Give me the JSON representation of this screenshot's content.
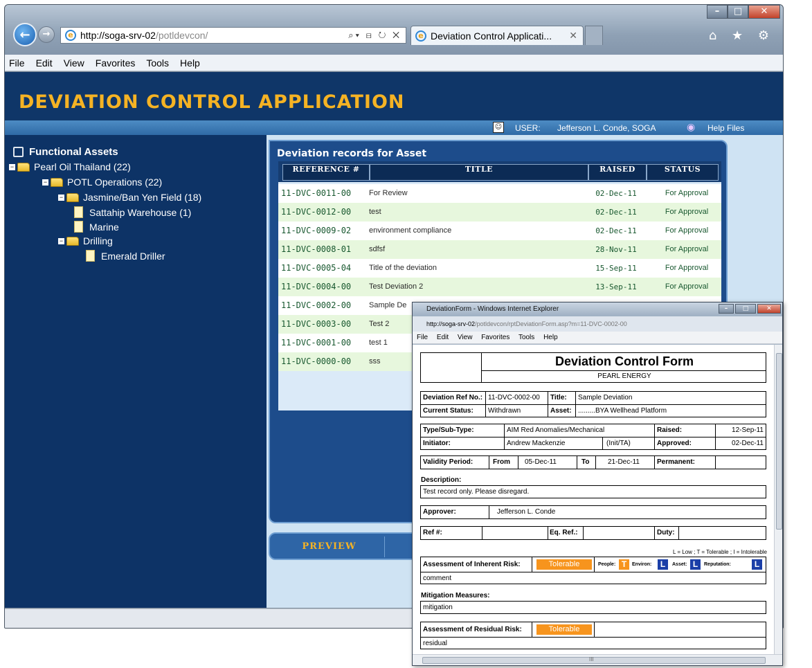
{
  "browser": {
    "url_host": "http://soga-srv-02",
    "url_path": "/potldevcon/",
    "address_tools": "⌕▾ ⊟ ↻ ✕",
    "tab_title": "Deviation Control Applicati...",
    "tab_close": "✕",
    "caption": {
      "minimize": "–",
      "maximize": "□",
      "close": "✕"
    },
    "right_icons": "⌂ ★ ⚙",
    "menu": [
      "File",
      "Edit",
      "View",
      "Favorites",
      "Tools",
      "Help"
    ]
  },
  "app": {
    "title": "DEVIATION CONTROL APPLICATION",
    "user_label": "USER:",
    "user_name": "Jefferson L. Conde, SOGA",
    "help_label": "Help Files"
  },
  "tree": {
    "root": "Functional Assets",
    "nodes": [
      "Pearl Oil Thailand (22)",
      "POTL Operations (22)",
      "Jasmine/Ban Yen Field (18)",
      "Sattahip Warehouse (1)",
      "Marine",
      "Drilling",
      "Emerald Driller"
    ]
  },
  "records": {
    "title": "Deviation records for Asset",
    "columns": [
      "REFERENCE #",
      "TITLE",
      "RAISED",
      "STATUS"
    ],
    "rows": [
      {
        "ref": "11-DVC-0011-00",
        "title": "For Review",
        "raised": "02-Dec-11",
        "status": "For Approval"
      },
      {
        "ref": "11-DVC-0012-00",
        "title": "test",
        "raised": "02-Dec-11",
        "status": "For Approval"
      },
      {
        "ref": "11-DVC-0009-02",
        "title": "environment compliance",
        "raised": "02-Dec-11",
        "status": "For Approval"
      },
      {
        "ref": "11-DVC-0008-01",
        "title": "sdfsf",
        "raised": "28-Nov-11",
        "status": "For Approval"
      },
      {
        "ref": "11-DVC-0005-04",
        "title": "Title of the deviation",
        "raised": "15-Sep-11",
        "status": "For Approval"
      },
      {
        "ref": "11-DVC-0004-00",
        "title": "Test Deviation 2",
        "raised": "13-Sep-11",
        "status": "For Approval"
      },
      {
        "ref": "11-DVC-0002-00",
        "title": "Sample De",
        "raised": "",
        "status": ""
      },
      {
        "ref": "11-DVC-0003-00",
        "title": "Test 2",
        "raised": "",
        "status": ""
      },
      {
        "ref": "11-DVC-0001-00",
        "title": "test 1",
        "raised": "",
        "status": ""
      },
      {
        "ref": "11-DVC-0000-00",
        "title": "sss",
        "raised": "",
        "status": ""
      }
    ],
    "preview_button": "PREVIEW"
  },
  "popup": {
    "window_title": "DeviationForm - Windows Internet Explorer",
    "url_host": "http://soga-srv-02",
    "url_path": "/potldevcon/rptDeviationForm.asp?m=11-DVC-0002-00",
    "menu": [
      "File",
      "Edit",
      "View",
      "Favorites",
      "Tools",
      "Help"
    ],
    "caption": {
      "minimize": "–",
      "maximize": "□",
      "close": "✕"
    },
    "form": {
      "heading": "Deviation Control Form",
      "company": "PEARL ENERGY",
      "ref_label": "Deviation Ref No.:",
      "ref_value": "11-DVC-0002-00",
      "title_label": "Title:",
      "title_value": "Sample Deviation",
      "status_label": "Current Status:",
      "status_value": "Withdrawn",
      "asset_label": "Asset:",
      "asset_value": ".........BYA Wellhead Platform",
      "type_label": "Type/Sub-Type:",
      "type_value": "AIM Red Anomalies/Mechanical",
      "raised_label": "Raised:",
      "raised_value": "12-Sep-11",
      "initiator_label": "Initiator:",
      "initiator_value": "Andrew Mackenzie",
      "init_ta": "(Init/TA)",
      "approved_label": "Approved:",
      "approved_value": "02-Dec-11",
      "validity_label": "Validity Period:",
      "from_label": "From",
      "from_value": "05-Dec-11",
      "to_label": "To",
      "to_value": "21-Dec-11",
      "permanent_label": "Permanent:",
      "description_label": "Description:",
      "description_value": "Test record only. Please disregard.",
      "approver_label": "Approver:",
      "approver_value": "Jefferson L. Conde",
      "refno_label": "Ref #:",
      "eqref_label": "Eq. Ref.:",
      "duty_label": "Duty:",
      "legend": "L = Low ; T = Tolerable ; I = Intolerable",
      "inherent_label": "Assessment of Inherent Risk:",
      "inherent_value": "Tolerable",
      "people_label": "People:",
      "people_value": "T",
      "environ_label": "Environ:",
      "environ_value": "L",
      "asset_risk_label": "Asset:",
      "asset_risk_value": "L",
      "reputation_label": "Reputation:",
      "reputation_value": "L",
      "inherent_comment": "comment",
      "mitigation_label": "Mitigation Measures:",
      "mitigation_value": "mitigation",
      "residual_label": "Assessment of Residual Risk:",
      "residual_value": "Tolerable",
      "residual_comment": "residual"
    },
    "hscroll_mark": "III"
  },
  "colors": {
    "app_header": "#0f3668",
    "title_gold": "#f5b324",
    "risk_orange": "#f7941d",
    "risk_blue": "#1b3fa8"
  }
}
